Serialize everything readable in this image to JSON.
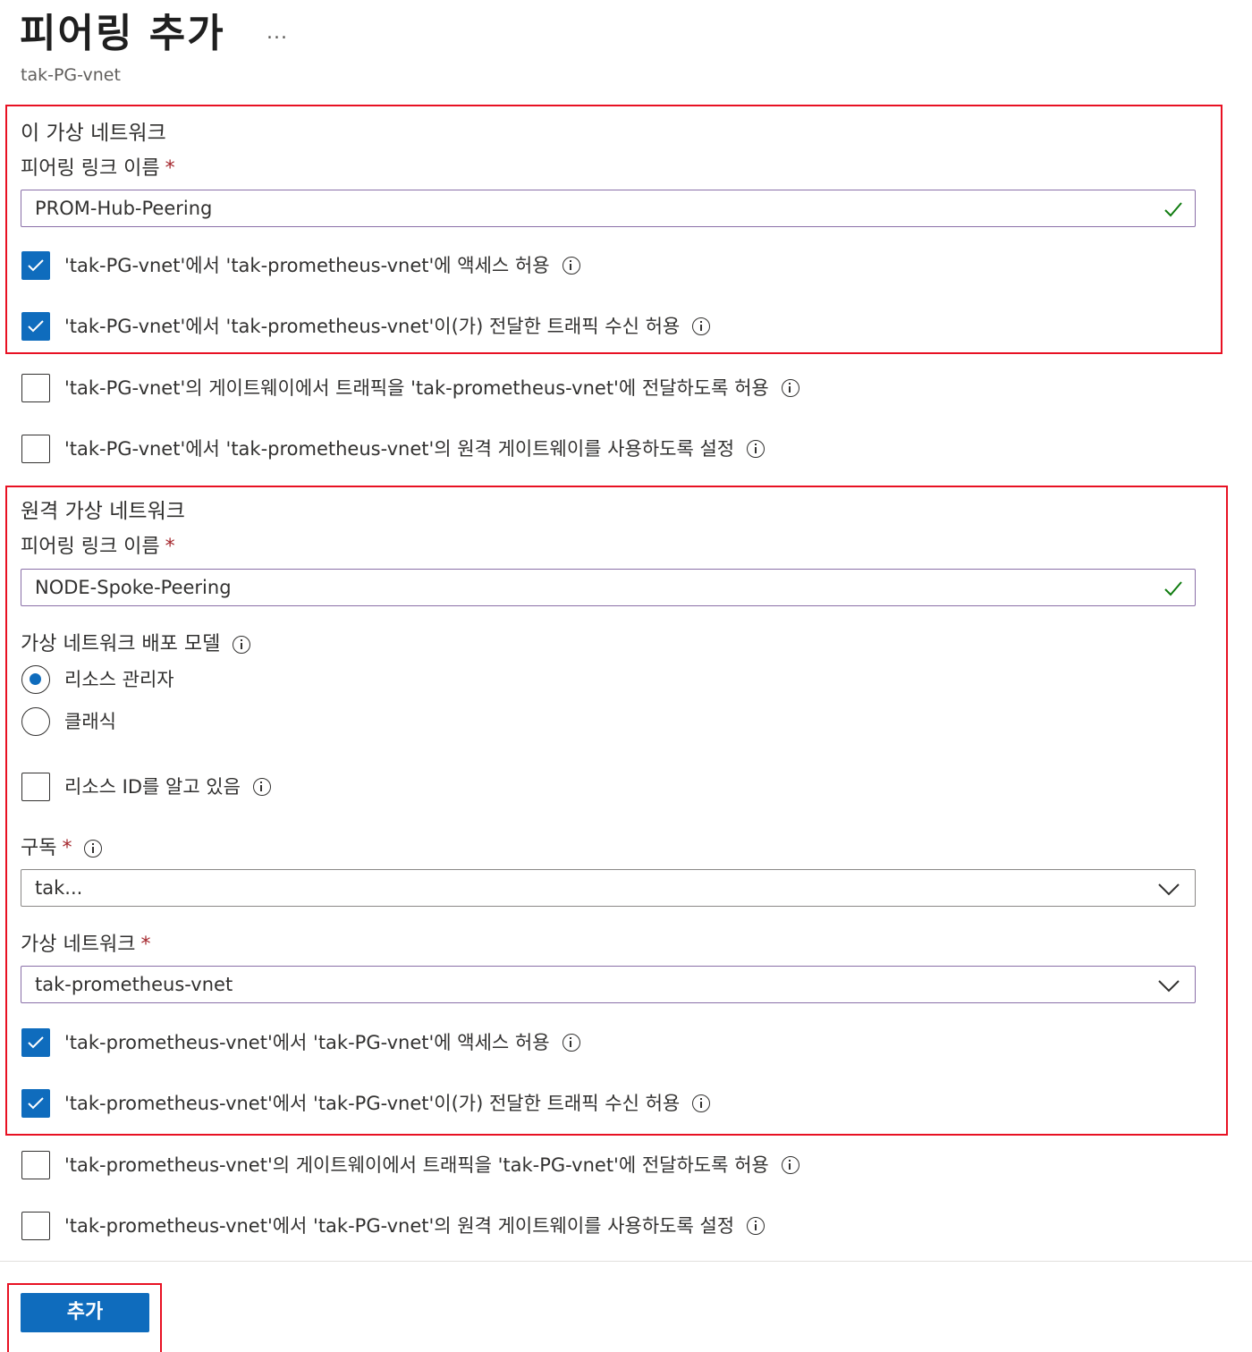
{
  "header": {
    "title": "피어링 추가",
    "more": "...",
    "subtitle": "tak-PG-vnet"
  },
  "local": {
    "section_title": "이 가상 네트워크",
    "link_name_label": "피어링 링크 이름",
    "required_mark": "*",
    "link_name_value": "PROM-Hub-Peering",
    "options": [
      {
        "label": "'tak-PG-vnet'에서 'tak-prometheus-vnet'에 액세스 허용",
        "checked": true
      },
      {
        "label": "'tak-PG-vnet'에서 'tak-prometheus-vnet'이(가) 전달한 트래픽 수신 허용",
        "checked": true
      },
      {
        "label": "'tak-PG-vnet'의 게이트웨이에서 트래픽을 'tak-prometheus-vnet'에 전달하도록 허용",
        "checked": false
      },
      {
        "label": "'tak-PG-vnet'에서 'tak-prometheus-vnet'의 원격 게이트웨이를 사용하도록 설정",
        "checked": false
      }
    ]
  },
  "remote": {
    "section_title": "원격 가상 네트워크",
    "link_name_label": "피어링 링크 이름",
    "required_mark": "*",
    "link_name_value": "NODE-Spoke-Peering",
    "deployment_model_label": "가상 네트워크 배포 모델",
    "deployment_models": [
      {
        "label": "리소스 관리자",
        "selected": true
      },
      {
        "label": "클래식",
        "selected": false
      }
    ],
    "know_resource_id": {
      "label": "리소스 ID를 알고 있음",
      "checked": false
    },
    "subscription_label": "구독",
    "subscription_value": "tak...",
    "vnet_label": "가상 네트워크",
    "vnet_value": "tak-prometheus-vnet",
    "options": [
      {
        "label": "'tak-prometheus-vnet'에서 'tak-PG-vnet'에 액세스 허용",
        "checked": true
      },
      {
        "label": "'tak-prometheus-vnet'에서 'tak-PG-vnet'이(가) 전달한 트래픽 수신 허용",
        "checked": true
      },
      {
        "label": "'tak-prometheus-vnet'의 게이트웨이에서 트래픽을 'tak-PG-vnet'에 전달하도록 허용",
        "checked": false
      },
      {
        "label": "'tak-prometheus-vnet'에서 'tak-PG-vnet'의 원격 게이트웨이를 사용하도록 설정",
        "checked": false
      }
    ]
  },
  "footer": {
    "add_label": "추가"
  },
  "colors": {
    "accent": "#0f6cbd",
    "highlight_box": "#e81123",
    "valid_check": "#107c10"
  }
}
